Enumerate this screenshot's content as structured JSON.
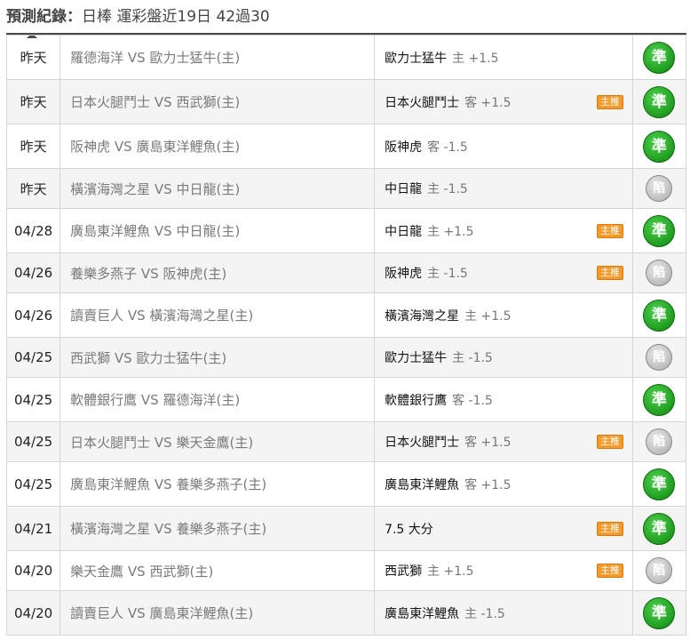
{
  "header": {
    "label": "預測紀錄：",
    "summary": "日棒 運彩盤近19日 42過30"
  },
  "colors": {
    "win": "#1f9d1f",
    "miss": "#bdbdbd",
    "hot": "#f39a2a"
  },
  "rows": [
    {
      "date": "昨天",
      "match": "羅德海洋 VS 歐力士猛牛(主)",
      "pick": "歐力士猛牛",
      "odds": "主 +1.5",
      "hot": "",
      "result": "準"
    },
    {
      "date": "昨天",
      "match": "日本火腿鬥士 VS 西武獅(主)",
      "pick": "日本火腿鬥士",
      "odds": "客 +1.5",
      "hot": "主推",
      "result": "準"
    },
    {
      "date": "昨天",
      "match": "阪神虎 VS 廣島東洋鯉魚(主)",
      "pick": "阪神虎",
      "odds": "客 -1.5",
      "hot": "",
      "result": "準"
    },
    {
      "date": "昨天",
      "match": "橫濱海灣之星 VS 中日龍(主)",
      "pick": "中日龍",
      "odds": "主 -1.5",
      "hot": "",
      "result": "陷"
    },
    {
      "date": "04/28",
      "match": "廣島東洋鯉魚 VS 中日龍(主)",
      "pick": "中日龍",
      "odds": "主 +1.5",
      "hot": "主推",
      "result": "準"
    },
    {
      "date": "04/26",
      "match": "養樂多燕子 VS 阪神虎(主)",
      "pick": "阪神虎",
      "odds": "主 -1.5",
      "hot": "主推",
      "result": "陷"
    },
    {
      "date": "04/26",
      "match": "讀賣巨人 VS 橫濱海灣之星(主)",
      "pick": "橫濱海灣之星",
      "odds": "主 +1.5",
      "hot": "",
      "result": "準"
    },
    {
      "date": "04/25",
      "match": "西武獅 VS 歐力士猛牛(主)",
      "pick": "歐力士猛牛",
      "odds": "主 -1.5",
      "hot": "",
      "result": "陷"
    },
    {
      "date": "04/25",
      "match": "軟體銀行鷹 VS 羅德海洋(主)",
      "pick": "軟體銀行鷹",
      "odds": "客 -1.5",
      "hot": "",
      "result": "準"
    },
    {
      "date": "04/25",
      "match": "日本火腿鬥士 VS 樂天金鷹(主)",
      "pick": "日本火腿鬥士",
      "odds": "客 +1.5",
      "hot": "主推",
      "result": "陷"
    },
    {
      "date": "04/25",
      "match": "廣島東洋鯉魚 VS 養樂多燕子(主)",
      "pick": "廣島東洋鯉魚",
      "odds": "客 +1.5",
      "hot": "",
      "result": "準"
    },
    {
      "date": "04/21",
      "match": "橫濱海灣之星 VS 養樂多燕子(主)",
      "pick": "7.5 大分",
      "odds": "",
      "hot": "主推",
      "result": "準"
    },
    {
      "date": "04/20",
      "match": "樂天金鷹 VS 西武獅(主)",
      "pick": "西武獅",
      "odds": "主 +1.5",
      "hot": "主推",
      "result": "陷"
    },
    {
      "date": "04/20",
      "match": "讀賣巨人 VS 廣島東洋鯉魚(主)",
      "pick": "廣島東洋鯉魚",
      "odds": "主 -1.5",
      "hot": "",
      "result": "準"
    }
  ]
}
